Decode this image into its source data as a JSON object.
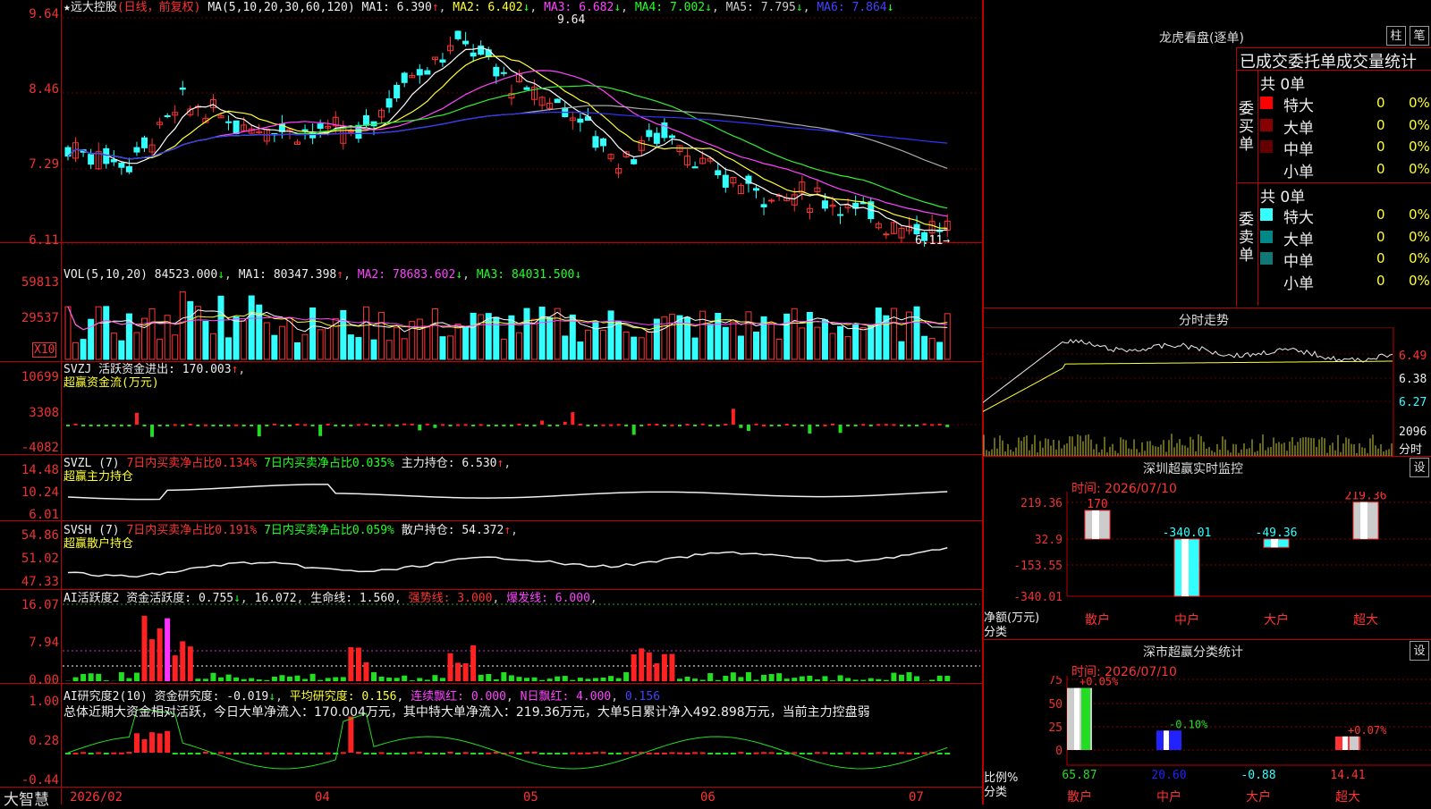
{
  "stock": {
    "name": "远大控股",
    "period": "(日线，前复权)"
  },
  "ma": {
    "params": "MA(5,10,20,30,60,120)",
    "items": [
      {
        "label": "MA1: 6.390",
        "arrow": "↑",
        "color": "#ffffff"
      },
      {
        "label": "MA2: 6.402",
        "arrow": "↓",
        "color": "#ffff33"
      },
      {
        "label": "MA3: 6.682",
        "arrow": "↓",
        "color": "#ff44ff"
      },
      {
        "label": "MA4: 7.002",
        "arrow": "↓",
        "color": "#33ee33"
      },
      {
        "label": "MA5: 7.795",
        "arrow": "↓",
        "color": "#cccccc"
      },
      {
        "label": "MA6: 7.864",
        "arrow": "↓",
        "color": "#3344ff"
      }
    ],
    "high_mark": "9.64",
    "low_mark": "6.11→"
  },
  "price_axis": [
    "9.64",
    "8.46",
    "7.29",
    "6.11"
  ],
  "volume": {
    "header": "VOL(5,10,20)",
    "value": "84523.000",
    "arrow": "↓",
    "ma1": "MA1: 80347.398",
    "ma1_arrow": "↑",
    "ma2": "MA2: 78683.602",
    "ma2_arrow": "↓",
    "ma3": "MA3: 84031.500",
    "ma3_arrow": "↓",
    "axis": [
      "59813",
      "29537"
    ],
    "unit": "X10"
  },
  "svzj": {
    "header": "SVZJ  活跃资金进出: 170.003",
    "arrow": "↑",
    "sub": "超赢资金流(万元)",
    "axis": [
      "10699",
      "3308",
      "-4082"
    ]
  },
  "svzl": {
    "header": "SVZL (7)",
    "p1": "7日内买卖净占比0.134%",
    "p2": "7日内买卖净占比0.035%",
    "p3": "主力持仓: 6.530",
    "arrow": "↑",
    "sub": "超赢主力持仓",
    "axis": [
      "14.48",
      "10.24",
      "6.01"
    ]
  },
  "svsh": {
    "header": "SVSH (7)",
    "p1": "7日内买卖净占比0.191%",
    "p2": "7日内买卖净占比0.059%",
    "p3": "散户持仓: 54.372",
    "arrow": "↑",
    "sub": "超赢散户持仓",
    "axis": [
      "54.86",
      "51.02",
      "47.33"
    ]
  },
  "ai2": {
    "header": "AI活跃度2 资金活跃度: 0.755",
    "arrow": "↓",
    "v2": "16.072",
    "l3": "生命线: 1.560",
    "l4": "强势线: 3.000",
    "l5": "爆发线: 6.000",
    "axis": [
      "16.07",
      "7.94",
      "0.00"
    ]
  },
  "ai_res": {
    "header": "AI研究度2(10) 资金研究度: -0.019",
    "arrow": "↓",
    "avg": "平均研究度: 0.156",
    "l3": "连续飘红: 0.000",
    "l4": "N日飘红: 4.000",
    "l5": "0.156",
    "summary": "总体近期大资金相对活跃，今日大单净流入：170.004万元，其中特大单净流入：219.36万元，大单5日累计净入492.898万元，当前主力控盘弱",
    "axis": [
      "1.00",
      "0.28",
      "-0.44"
    ]
  },
  "date_axis": [
    "2026/02",
    "04",
    "05",
    "06",
    "07"
  ],
  "brand": "大智慧",
  "right": {
    "title": "龙虎看盘(逐单)",
    "btn1": "柱",
    "btn2": "笔",
    "stats_title": "已成交委托单成交量统计",
    "buy_total": "共 0单",
    "buy_label": "委买单",
    "sell_total": "共 0单",
    "sell_label": "委卖单",
    "rows": [
      {
        "name": "特大",
        "qty": "0",
        "pct": "0%"
      },
      {
        "name": "大单",
        "qty": "0",
        "pct": "0%"
      },
      {
        "name": "中单",
        "qty": "0",
        "pct": "0%"
      },
      {
        "name": "小单",
        "qty": "0",
        "pct": "0%"
      }
    ],
    "sell_rows": [
      {
        "name": "特大",
        "qty": "0",
        "pct": "0%"
      },
      {
        "name": "大单",
        "qty": "0",
        "pct": "0%"
      },
      {
        "name": "中单",
        "qty": "0",
        "pct": "0%"
      },
      {
        "name": "小单",
        "qty": "0",
        "pct": "0%"
      }
    ],
    "intraday": {
      "title": "分时走势",
      "axis": [
        "6.49",
        "6.38",
        "6.27"
      ],
      "vol_axis": [
        "2096",
        "分时"
      ]
    },
    "sz_monitor": {
      "title": "深圳超赢实时监控",
      "btn": "设",
      "time": "时间: 2026/07/10",
      "axis": [
        "219.36",
        "32.9",
        "-153.55",
        "-340.01"
      ],
      "values": [
        {
          "cat": "散户",
          "value": 170
        },
        {
          "cat": "中户",
          "value": -340.01
        },
        {
          "cat": "大户",
          "value": -49.36
        },
        {
          "cat": "超大",
          "value": 219.36
        }
      ],
      "labels": [
        "170",
        "-340.01",
        "-49.36",
        "219.36"
      ],
      "ylabel": "净额(万元)",
      "xlabel": "分类"
    },
    "sz_class": {
      "title": "深市超赢分类统计",
      "btn": "设",
      "time": "时间: 2026/07/10",
      "axis": [
        "75",
        "50",
        "25",
        "0"
      ],
      "bars": [
        {
          "cat": "散户",
          "value": 65.87,
          "delta": "+0.05%"
        },
        {
          "cat": "中户",
          "value": 20.6,
          "delta": "-0.10%"
        },
        {
          "cat": "大户",
          "value": -0.88,
          "delta": ""
        },
        {
          "cat": "超大",
          "value": 14.41,
          "delta": "+0.07%"
        }
      ],
      "values_text": [
        "65.87",
        "20.60",
        "-0.88",
        "14.41"
      ],
      "ylabel": "比例%",
      "xlabel": "分类"
    }
  }
}
